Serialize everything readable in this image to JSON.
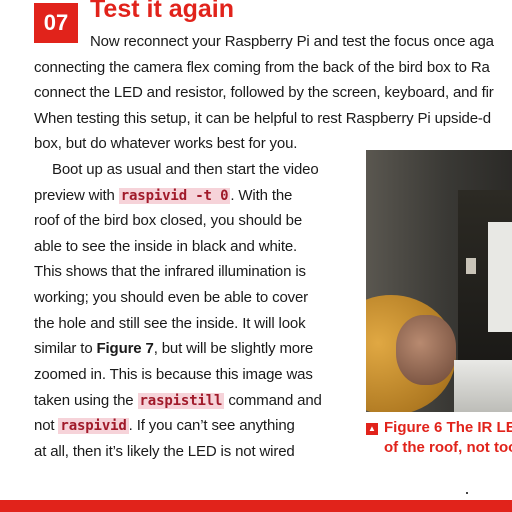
{
  "section": {
    "number": "07",
    "title": "Test it again"
  },
  "paragraph1": {
    "lines": [
      "Now reconnect your Raspberry Pi and test the focus once aga",
      "connecting the camera flex coming from the back of the bird box to Ra",
      "connect the LED and resistor, followed by the screen, keyboard, and fir",
      "When testing this setup, it can be helpful to rest Raspberry Pi upside-d",
      "box, but do whatever works best for you."
    ]
  },
  "paragraph2": {
    "l1": "Boot up as usual and then start the video",
    "l2a": "preview with ",
    "l2_code": "raspivid -t 0",
    "l2b": ". With the",
    "l3": "roof of the bird box closed, you should be",
    "l4": "able to see the inside in black and white.",
    "l5": "This shows that the infrared illumination is",
    "l6": "working; you should even be able to cover",
    "l7": "the hole and still see the inside. It will look",
    "l8a": "similar to ",
    "l8_bold": "Figure 7",
    "l8b": ", but will be slightly more",
    "l9": "zoomed in. This is because this image was",
    "l10a": "taken using the ",
    "l10_code": "raspistill",
    "l10b": " command and",
    "l11a": "not ",
    "l11_code": "raspivid",
    "l11b": ". If you can’t see anything",
    "l12": "at all, then it’s likely the LED is not wired"
  },
  "caption": {
    "icon": "▲",
    "line1_bold": "Figure 6",
    "line1_rest": " The IR LE",
    "line2": "of the roof, not too"
  },
  "colors": {
    "accent": "#e1231b",
    "code_bg": "#f6d3d9",
    "code_text": "#a01a2a"
  }
}
